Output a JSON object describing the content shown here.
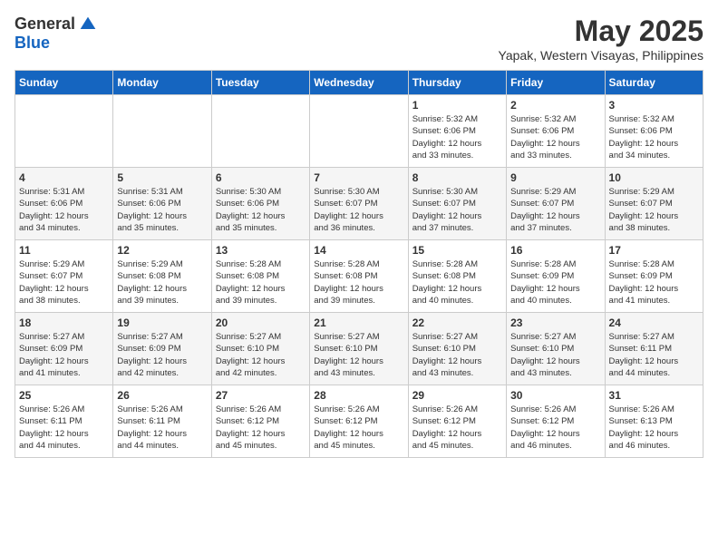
{
  "logo": {
    "general": "General",
    "blue": "Blue"
  },
  "header": {
    "month": "May 2025",
    "location": "Yapak, Western Visayas, Philippines"
  },
  "weekdays": [
    "Sunday",
    "Monday",
    "Tuesday",
    "Wednesday",
    "Thursday",
    "Friday",
    "Saturday"
  ],
  "weeks": [
    [
      {
        "day": "",
        "info": ""
      },
      {
        "day": "",
        "info": ""
      },
      {
        "day": "",
        "info": ""
      },
      {
        "day": "",
        "info": ""
      },
      {
        "day": "1",
        "info": "Sunrise: 5:32 AM\nSunset: 6:06 PM\nDaylight: 12 hours\nand 33 minutes."
      },
      {
        "day": "2",
        "info": "Sunrise: 5:32 AM\nSunset: 6:06 PM\nDaylight: 12 hours\nand 33 minutes."
      },
      {
        "day": "3",
        "info": "Sunrise: 5:32 AM\nSunset: 6:06 PM\nDaylight: 12 hours\nand 34 minutes."
      }
    ],
    [
      {
        "day": "4",
        "info": "Sunrise: 5:31 AM\nSunset: 6:06 PM\nDaylight: 12 hours\nand 34 minutes."
      },
      {
        "day": "5",
        "info": "Sunrise: 5:31 AM\nSunset: 6:06 PM\nDaylight: 12 hours\nand 35 minutes."
      },
      {
        "day": "6",
        "info": "Sunrise: 5:30 AM\nSunset: 6:06 PM\nDaylight: 12 hours\nand 35 minutes."
      },
      {
        "day": "7",
        "info": "Sunrise: 5:30 AM\nSunset: 6:07 PM\nDaylight: 12 hours\nand 36 minutes."
      },
      {
        "day": "8",
        "info": "Sunrise: 5:30 AM\nSunset: 6:07 PM\nDaylight: 12 hours\nand 37 minutes."
      },
      {
        "day": "9",
        "info": "Sunrise: 5:29 AM\nSunset: 6:07 PM\nDaylight: 12 hours\nand 37 minutes."
      },
      {
        "day": "10",
        "info": "Sunrise: 5:29 AM\nSunset: 6:07 PM\nDaylight: 12 hours\nand 38 minutes."
      }
    ],
    [
      {
        "day": "11",
        "info": "Sunrise: 5:29 AM\nSunset: 6:07 PM\nDaylight: 12 hours\nand 38 minutes."
      },
      {
        "day": "12",
        "info": "Sunrise: 5:29 AM\nSunset: 6:08 PM\nDaylight: 12 hours\nand 39 minutes."
      },
      {
        "day": "13",
        "info": "Sunrise: 5:28 AM\nSunset: 6:08 PM\nDaylight: 12 hours\nand 39 minutes."
      },
      {
        "day": "14",
        "info": "Sunrise: 5:28 AM\nSunset: 6:08 PM\nDaylight: 12 hours\nand 39 minutes."
      },
      {
        "day": "15",
        "info": "Sunrise: 5:28 AM\nSunset: 6:08 PM\nDaylight: 12 hours\nand 40 minutes."
      },
      {
        "day": "16",
        "info": "Sunrise: 5:28 AM\nSunset: 6:09 PM\nDaylight: 12 hours\nand 40 minutes."
      },
      {
        "day": "17",
        "info": "Sunrise: 5:28 AM\nSunset: 6:09 PM\nDaylight: 12 hours\nand 41 minutes."
      }
    ],
    [
      {
        "day": "18",
        "info": "Sunrise: 5:27 AM\nSunset: 6:09 PM\nDaylight: 12 hours\nand 41 minutes."
      },
      {
        "day": "19",
        "info": "Sunrise: 5:27 AM\nSunset: 6:09 PM\nDaylight: 12 hours\nand 42 minutes."
      },
      {
        "day": "20",
        "info": "Sunrise: 5:27 AM\nSunset: 6:10 PM\nDaylight: 12 hours\nand 42 minutes."
      },
      {
        "day": "21",
        "info": "Sunrise: 5:27 AM\nSunset: 6:10 PM\nDaylight: 12 hours\nand 43 minutes."
      },
      {
        "day": "22",
        "info": "Sunrise: 5:27 AM\nSunset: 6:10 PM\nDaylight: 12 hours\nand 43 minutes."
      },
      {
        "day": "23",
        "info": "Sunrise: 5:27 AM\nSunset: 6:10 PM\nDaylight: 12 hours\nand 43 minutes."
      },
      {
        "day": "24",
        "info": "Sunrise: 5:27 AM\nSunset: 6:11 PM\nDaylight: 12 hours\nand 44 minutes."
      }
    ],
    [
      {
        "day": "25",
        "info": "Sunrise: 5:26 AM\nSunset: 6:11 PM\nDaylight: 12 hours\nand 44 minutes."
      },
      {
        "day": "26",
        "info": "Sunrise: 5:26 AM\nSunset: 6:11 PM\nDaylight: 12 hours\nand 44 minutes."
      },
      {
        "day": "27",
        "info": "Sunrise: 5:26 AM\nSunset: 6:12 PM\nDaylight: 12 hours\nand 45 minutes."
      },
      {
        "day": "28",
        "info": "Sunrise: 5:26 AM\nSunset: 6:12 PM\nDaylight: 12 hours\nand 45 minutes."
      },
      {
        "day": "29",
        "info": "Sunrise: 5:26 AM\nSunset: 6:12 PM\nDaylight: 12 hours\nand 45 minutes."
      },
      {
        "day": "30",
        "info": "Sunrise: 5:26 AM\nSunset: 6:12 PM\nDaylight: 12 hours\nand 46 minutes."
      },
      {
        "day": "31",
        "info": "Sunrise: 5:26 AM\nSunset: 6:13 PM\nDaylight: 12 hours\nand 46 minutes."
      }
    ]
  ]
}
